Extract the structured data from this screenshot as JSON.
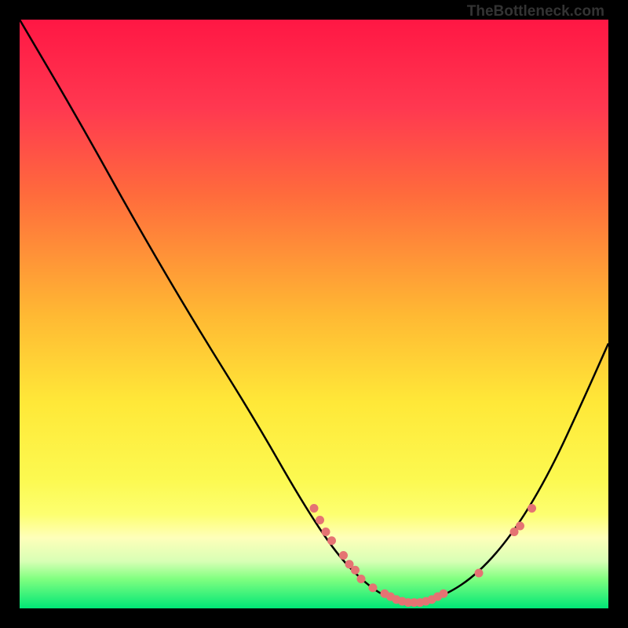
{
  "watermark": "TheBottleneck.com",
  "chart_data": {
    "type": "line",
    "title": "",
    "xlabel": "",
    "ylabel": "",
    "xlim": [
      0,
      100
    ],
    "ylim": [
      0,
      100
    ],
    "gradient_stops": [
      {
        "offset": 0,
        "color": "#ff1744"
      },
      {
        "offset": 15,
        "color": "#ff3850"
      },
      {
        "offset": 30,
        "color": "#ff6c3c"
      },
      {
        "offset": 50,
        "color": "#ffb833"
      },
      {
        "offset": 65,
        "color": "#ffe838"
      },
      {
        "offset": 78,
        "color": "#fcf950"
      },
      {
        "offset": 84,
        "color": "#fdff70"
      },
      {
        "offset": 88,
        "color": "#feffba"
      },
      {
        "offset": 92,
        "color": "#d8ffb5"
      },
      {
        "offset": 95,
        "color": "#80ff80"
      },
      {
        "offset": 100,
        "color": "#00e676"
      }
    ],
    "curve_points": [
      {
        "x": 0,
        "y": 0
      },
      {
        "x": 10,
        "y": 17
      },
      {
        "x": 20,
        "y": 35
      },
      {
        "x": 30,
        "y": 52
      },
      {
        "x": 40,
        "y": 68
      },
      {
        "x": 48,
        "y": 82
      },
      {
        "x": 54,
        "y": 91
      },
      {
        "x": 59,
        "y": 96
      },
      {
        "x": 63,
        "y": 98.5
      },
      {
        "x": 67,
        "y": 99
      },
      {
        "x": 72,
        "y": 98
      },
      {
        "x": 78,
        "y": 94
      },
      {
        "x": 84,
        "y": 87
      },
      {
        "x": 90,
        "y": 77
      },
      {
        "x": 96,
        "y": 64
      },
      {
        "x": 100,
        "y": 55
      }
    ],
    "scatter_points": [
      {
        "x": 50,
        "y": 83
      },
      {
        "x": 51,
        "y": 85
      },
      {
        "x": 52,
        "y": 87
      },
      {
        "x": 53,
        "y": 88.5
      },
      {
        "x": 55,
        "y": 91
      },
      {
        "x": 56,
        "y": 92.5
      },
      {
        "x": 57,
        "y": 93.5
      },
      {
        "x": 58,
        "y": 95
      },
      {
        "x": 60,
        "y": 96.5
      },
      {
        "x": 62,
        "y": 97.5
      },
      {
        "x": 63,
        "y": 98
      },
      {
        "x": 64,
        "y": 98.5
      },
      {
        "x": 65,
        "y": 98.8
      },
      {
        "x": 66,
        "y": 99
      },
      {
        "x": 67,
        "y": 99
      },
      {
        "x": 68,
        "y": 99
      },
      {
        "x": 69,
        "y": 98.8
      },
      {
        "x": 70,
        "y": 98.5
      },
      {
        "x": 71,
        "y": 98
      },
      {
        "x": 72,
        "y": 97.5
      },
      {
        "x": 78,
        "y": 94
      },
      {
        "x": 84,
        "y": 87
      },
      {
        "x": 85,
        "y": 86
      },
      {
        "x": 87,
        "y": 83
      }
    ],
    "scatter_color": "#e57373",
    "curve_color": "#000000"
  }
}
